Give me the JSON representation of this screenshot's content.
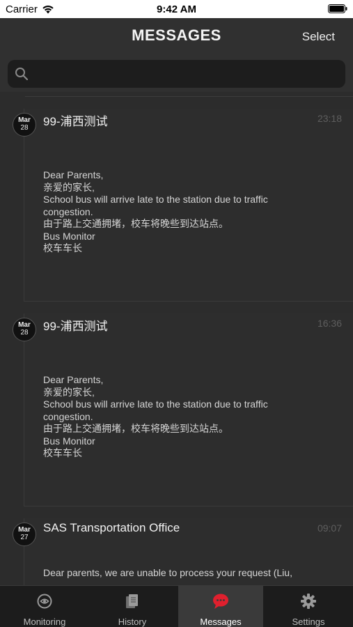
{
  "status_bar": {
    "carrier": "Carrier",
    "time": "9:42 AM"
  },
  "nav": {
    "title": "MESSAGES",
    "select_label": "Select"
  },
  "search": {
    "placeholder": ""
  },
  "messages": [
    {
      "month": "Mar",
      "day": "28",
      "title": "99-浦西测试",
      "time": "23:18",
      "lines": [
        "Dear Parents,",
        "亲爱的家长,",
        "School bus will arrive late to the station due to traffic",
        "congestion.",
        "由于路上交通拥堵，校车将晚些到达站点。",
        "Bus Monitor",
        "校车车长"
      ]
    },
    {
      "month": "Mar",
      "day": "28",
      "title": "99-浦西测试",
      "time": "16:36",
      "lines": [
        "Dear Parents,",
        "亲爱的家长,",
        "School bus will arrive late to the station due to traffic",
        "congestion.",
        "由于路上交通拥堵，校车将晚些到达站点。",
        "Bus Monitor",
        "校车车长"
      ]
    },
    {
      "month": "Mar",
      "day": "27",
      "title": "SAS Transportation Office",
      "time": "09:07",
      "lines": [
        "Dear parents, we are unable to process your request (Liu,"
      ]
    }
  ],
  "tabs": [
    {
      "label": "Monitoring",
      "icon": "monitoring-icon",
      "active": false
    },
    {
      "label": "History",
      "icon": "history-icon",
      "active": false
    },
    {
      "label": "Messages",
      "icon": "messages-icon",
      "active": true
    },
    {
      "label": "Settings",
      "icon": "gear-icon",
      "active": false
    }
  ],
  "colors": {
    "accent": "#e0202e",
    "background": "#2c2c2c",
    "tab_bar": "#1c1c1c"
  }
}
